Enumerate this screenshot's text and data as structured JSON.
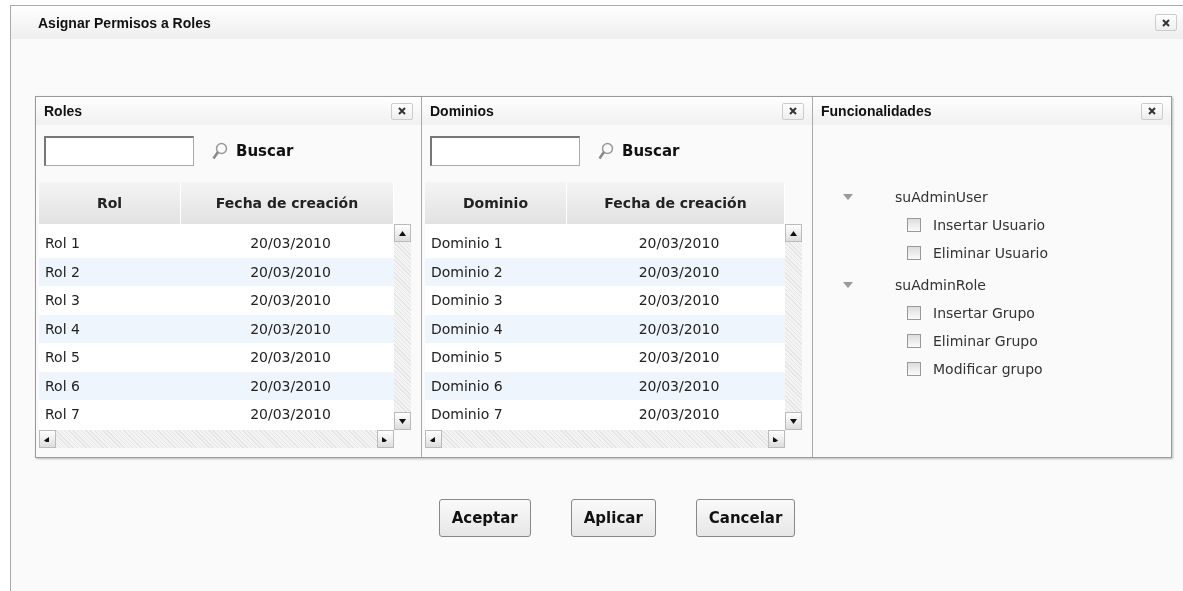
{
  "window": {
    "title": "Asignar Permisos a Roles"
  },
  "panels": [
    {
      "kind": "grid",
      "title": "Roles",
      "search_label": "Buscar",
      "columns": [
        "Rol",
        "Fecha de creación"
      ],
      "rows": [
        [
          "Rol 1",
          "20/03/2010"
        ],
        [
          "Rol 2",
          "20/03/2010"
        ],
        [
          "Rol 3",
          "20/03/2010"
        ],
        [
          "Rol 4",
          "20/03/2010"
        ],
        [
          "Rol 5",
          "20/03/2010"
        ],
        [
          "Rol 6",
          "20/03/2010"
        ],
        [
          "Rol 7",
          "20/03/2010"
        ]
      ]
    },
    {
      "kind": "grid",
      "title": "Dominios",
      "search_label": "Buscar",
      "columns": [
        "Dominio",
        "Fecha de creación"
      ],
      "rows": [
        [
          "Dominio 1",
          "20/03/2010"
        ],
        [
          "Dominio 2",
          "20/03/2010"
        ],
        [
          "Dominio 3",
          "20/03/2010"
        ],
        [
          "Dominio 4",
          "20/03/2010"
        ],
        [
          "Dominio 5",
          "20/03/2010"
        ],
        [
          "Dominio 6",
          "20/03/2010"
        ],
        [
          "Dominio 7",
          "20/03/2010"
        ]
      ]
    },
    {
      "kind": "tree",
      "title": "Funcionalidades",
      "groups": [
        {
          "label": "suAdminUser",
          "expanded": true,
          "children": [
            {
              "label": "Insertar Usuario",
              "checked": false
            },
            {
              "label": "Eliminar Usuario",
              "checked": false
            }
          ]
        },
        {
          "label": "suAdminRole",
          "expanded": true,
          "children": [
            {
              "label": "Insertar Grupo",
              "checked": false
            },
            {
              "label": "Eliminar Grupo",
              "checked": false
            },
            {
              "label": "Modificar grupo",
              "checked": false
            }
          ]
        }
      ]
    }
  ],
  "buttons": [
    "Aceptar",
    "Aplicar",
    "Cancelar"
  ]
}
